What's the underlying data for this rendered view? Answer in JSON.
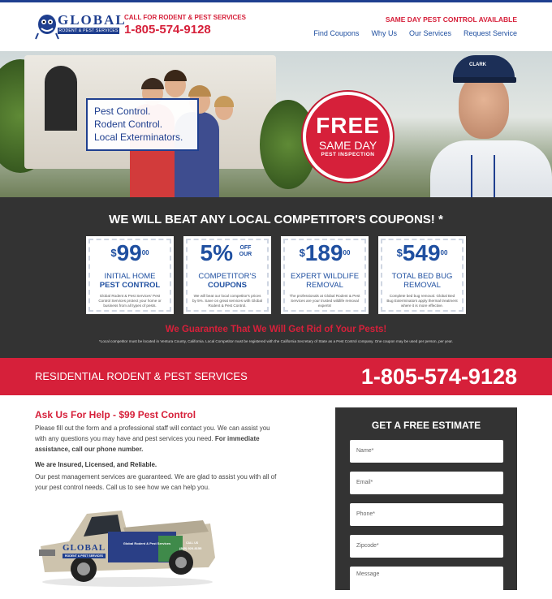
{
  "header": {
    "logo_text": "GLOBAL",
    "logo_sub": "RODENT & PEST SERVICES",
    "call_line": "CALL FOR RODENT & PEST SERVICES",
    "phone": "1-805-574-9128",
    "same_day": "SAME DAY PEST CONTROL AVAILABLE",
    "nav": [
      "Find Coupons",
      "Why Us",
      "Our Services",
      "Request Service"
    ]
  },
  "hero": {
    "tag_lines": [
      "Pest Control.",
      "Rodent Control.",
      "Local Exterminators."
    ],
    "badge": {
      "line1": "FREE",
      "line2": "SAME DAY",
      "line3": "PEST INSPECTION"
    },
    "cap_logo": "CLARK"
  },
  "coupons": {
    "heading": "WE WILL BEAT ANY LOCAL COMPETITOR'S COUPONS! *",
    "cards": [
      {
        "currency": "$",
        "amount": "99",
        "sup": "00",
        "line1": "INITIAL HOME",
        "line2": "PEST CONTROL",
        "desc": "Global Rodent & Pest Services' Pest Control Services protect your home or business from all types of pests."
      },
      {
        "currency": "",
        "amount": "5%",
        "sup": "OFF OUR",
        "line1": "COMPETITOR'S",
        "line2": "COUPONS",
        "desc": "We will beat our local competitor's prices by 5%. Save on great services with Global Rodent & Pest Control."
      },
      {
        "currency": "$",
        "amount": "189",
        "sup": "00",
        "line1": "EXPERT WILDLIFE",
        "line2": "REMOVAL",
        "desc": "The professionals at Global Rodent & Pest Services are your trusted wildlife removal experts!"
      },
      {
        "currency": "$",
        "amount": "549",
        "sup": "00",
        "line1": "TOTAL BED BUG",
        "line2": "REMOVAL",
        "desc": "Complete bed bug removal. Global Bed Bug Exterminators apply thermal treatment where it is more effective."
      }
    ],
    "guarantee": "We Guarantee That We Will Get Rid of Your Pests!",
    "fine_print": "*Local competitor must be located in Ventura County, California. Local Competitor must be registered with the California Secretary of State as a Pest Control company. One coupon may be used per person, per year."
  },
  "band": {
    "label": "RESIDENTIAL RODENT & PEST SERVICES",
    "phone": "1-805-574-9128"
  },
  "main": {
    "ask_title": "Ask Us For Help - $99 Pest Control",
    "para1": "Please fill out the form and a professional staff will contact you. We can assist you with any questions you may have and pest services you need.",
    "para1_bold": "For immediate assistance, call our phone number.",
    "insured": "We are Insured, Licensed, and Reliable.",
    "para2": "Our pest management services are guaranteed. We are glad to assist you with all of your pest control needs. Call us to see how we can help you.",
    "truck_panel": "Global Rodent & Pest Services",
    "truck_logo": "GLOBAL",
    "truck_sub": "RODENT & PEST SERVICES",
    "truck_call": "CALL US",
    "truck_phone": "(805) 920-8155"
  },
  "form": {
    "title": "GET A FREE ESTIMATE",
    "fields": [
      "Name*",
      "Email*",
      "Phone*",
      "Zipcode*",
      "Message"
    ]
  },
  "colors": {
    "brand_blue": "#1f3f8f",
    "brand_red": "#d6203a",
    "dark": "#333333"
  }
}
